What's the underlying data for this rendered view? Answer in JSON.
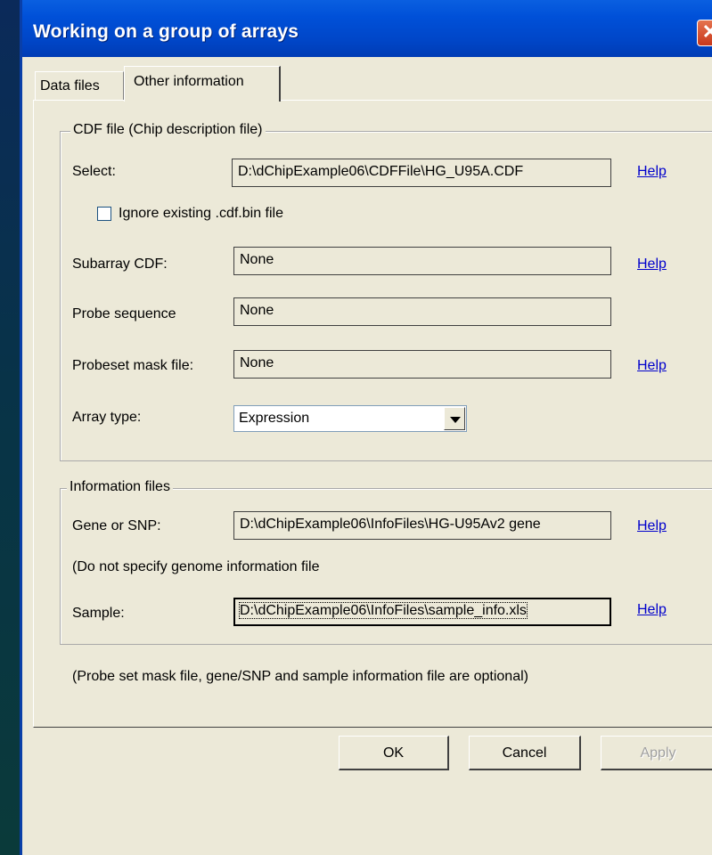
{
  "window": {
    "title": "Working on a group of arrays",
    "close_glyph": "✕"
  },
  "tabs": [
    {
      "label": "Data files",
      "active": false
    },
    {
      "label": "Other information",
      "active": true
    }
  ],
  "cdf_group": {
    "legend": "CDF file (Chip description file)",
    "select_label": "Select:",
    "select_value": "D:\\dChipExample06\\CDFFile\\HG_U95A.CDF",
    "ignore_checkbox_label": "Ignore existing .cdf.bin file",
    "ignore_checked": false,
    "subarray_label": "Subarray CDF:",
    "subarray_value": "None",
    "probe_seq_label": "Probe sequence",
    "probe_seq_value": "None",
    "probeset_mask_label": "Probeset mask file:",
    "probeset_mask_value": "None",
    "array_type_label": "Array type:",
    "array_type_value": "Expression"
  },
  "info_group": {
    "legend": "Information files",
    "gene_label": "Gene or SNP:",
    "gene_value": "D:\\dChipExample06\\InfoFiles\\HG-U95Av2 gene",
    "genome_note": "(Do not specify genome information file",
    "sample_label": "Sample:",
    "sample_value": "D:\\dChipExample06\\InfoFiles\\sample_info.xls"
  },
  "help_label": "Help",
  "footnote": "(Probe set mask file, gene/SNP and sample information file are optional)",
  "buttons": {
    "ok": "OK",
    "cancel": "Cancel",
    "apply": "Apply"
  }
}
